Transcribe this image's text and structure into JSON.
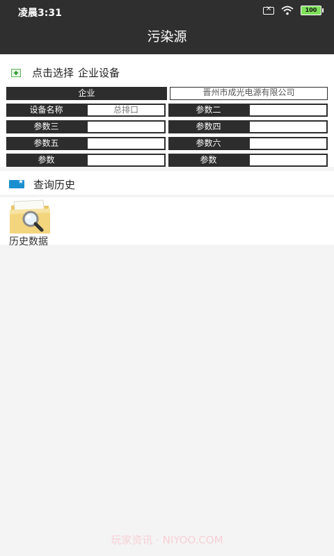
{
  "status_bar": {
    "time": "凌晨3:31",
    "battery": "100",
    "icons": [
      "sim-missing-icon",
      "wifi-icon",
      "battery-icon"
    ]
  },
  "app_bar": {
    "title": "污染源"
  },
  "selector": {
    "title_part1": "点击选择",
    "title_part2": "企业设备",
    "icon": "select-plus-icon"
  },
  "form": {
    "enterprise_label": "企业",
    "enterprise_value": "晋州市成光电源有限公司",
    "rows": [
      [
        {
          "label": "设备名称",
          "value": "总排口"
        },
        {
          "label": "参数二",
          "value": ""
        }
      ],
      [
        {
          "label": "参数三",
          "value": ""
        },
        {
          "label": "参数四",
          "value": ""
        }
      ],
      [
        {
          "label": "参数五",
          "value": ""
        },
        {
          "label": "参数六",
          "value": ""
        }
      ],
      [
        {
          "label": "参数",
          "value": ""
        },
        {
          "label": "参数",
          "value": ""
        }
      ]
    ]
  },
  "history": {
    "title": "查询历史",
    "items": [
      {
        "label": "历史数据",
        "icon": "folder-magnifier-icon"
      }
    ]
  },
  "watermark": "玩家资讯 · NIYOO.COM",
  "colors": {
    "header_bg": "#2f2f2f",
    "label_bg": "#2d2d2d",
    "accent_blue": "#1a8fd0",
    "battery_green": "#7ee05b"
  }
}
